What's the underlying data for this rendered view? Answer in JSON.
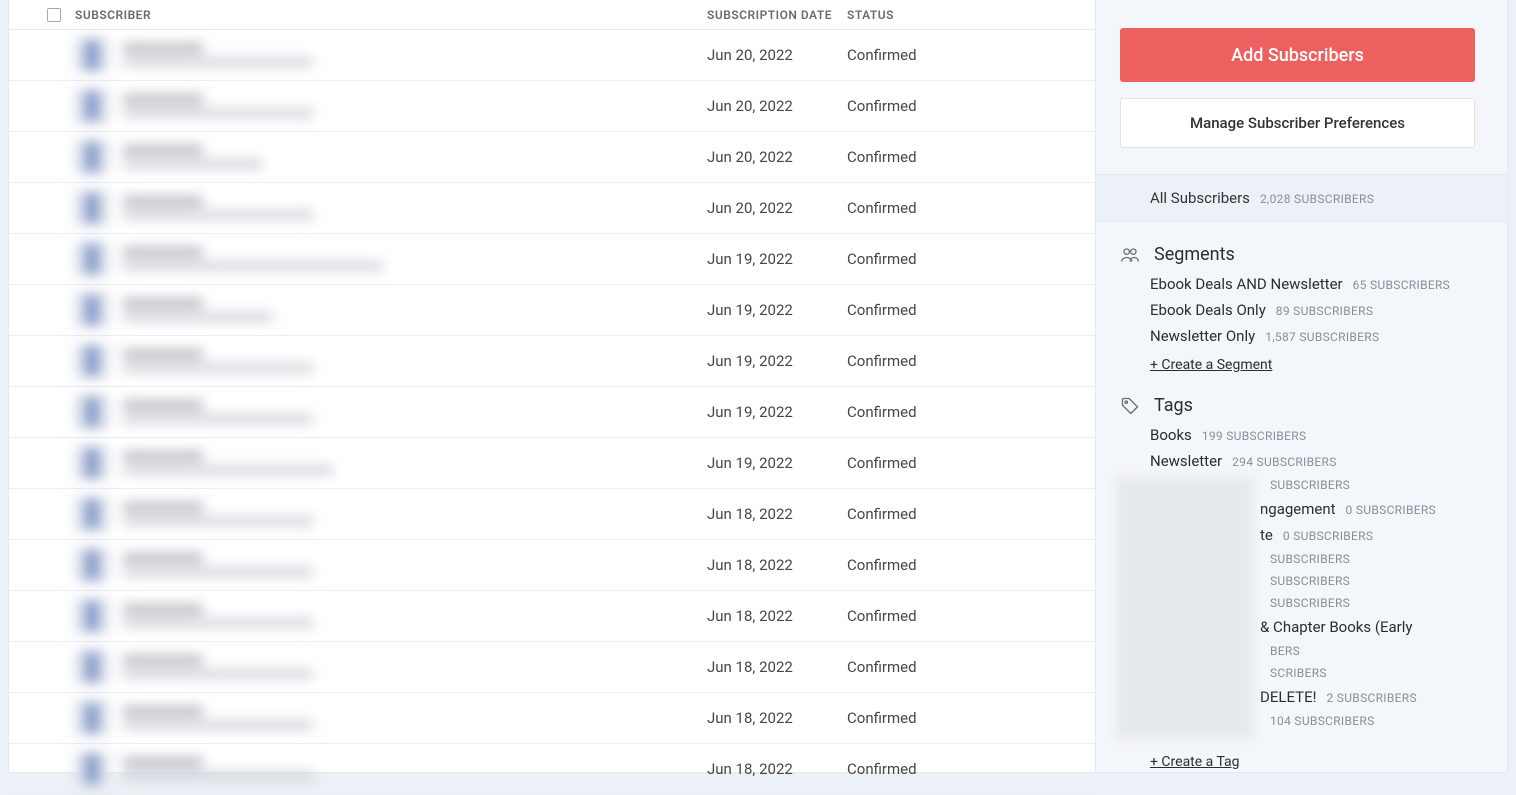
{
  "columns": {
    "subscriber": "SUBSCRIBER",
    "date": "SUBSCRIPTION DATE",
    "status": "STATUS"
  },
  "rows": [
    {
      "date": "Jun 20, 2022",
      "status": "Confirmed"
    },
    {
      "date": "Jun 20, 2022",
      "status": "Confirmed"
    },
    {
      "date": "Jun 20, 2022",
      "status": "Confirmed"
    },
    {
      "date": "Jun 20, 2022",
      "status": "Confirmed"
    },
    {
      "date": "Jun 19, 2022",
      "status": "Confirmed"
    },
    {
      "date": "Jun 19, 2022",
      "status": "Confirmed"
    },
    {
      "date": "Jun 19, 2022",
      "status": "Confirmed"
    },
    {
      "date": "Jun 19, 2022",
      "status": "Confirmed"
    },
    {
      "date": "Jun 19, 2022",
      "status": "Confirmed"
    },
    {
      "date": "Jun 18, 2022",
      "status": "Confirmed"
    },
    {
      "date": "Jun 18, 2022",
      "status": "Confirmed"
    },
    {
      "date": "Jun 18, 2022",
      "status": "Confirmed"
    },
    {
      "date": "Jun 18, 2022",
      "status": "Confirmed"
    },
    {
      "date": "Jun 18, 2022",
      "status": "Confirmed"
    },
    {
      "date": "Jun 18, 2022",
      "status": "Confirmed"
    }
  ],
  "sidebar": {
    "add_btn": "Add Subscribers",
    "manage_btn": "Manage Subscriber Preferences",
    "all_label": "All Subscribers",
    "all_count": "2,028 SUBSCRIBERS",
    "segments_title": "Segments",
    "segments": [
      {
        "label": "Ebook Deals AND Newsletter",
        "count": "65 SUBSCRIBERS"
      },
      {
        "label": "Ebook Deals Only",
        "count": "89 SUBSCRIBERS"
      },
      {
        "label": "Newsletter Only",
        "count": "1,587 SUBSCRIBERS"
      }
    ],
    "create_segment": "+ Create a Segment",
    "tags_title": "Tags",
    "tags": [
      {
        "label": "Books",
        "count": "199 SUBSCRIBERS"
      },
      {
        "label": "Newsletter",
        "count": "294 SUBSCRIBERS"
      },
      {
        "label": "",
        "count": "SUBSCRIBERS"
      },
      {
        "label": "ngagement",
        "count": "0 SUBSCRIBERS"
      },
      {
        "label": "te",
        "count": "0 SUBSCRIBERS"
      },
      {
        "label": "",
        "count": "SUBSCRIBERS"
      },
      {
        "label": "",
        "count": "SUBSCRIBERS"
      },
      {
        "label": "",
        "count": "SUBSCRIBERS"
      },
      {
        "label": "& Chapter Books (Early",
        "count": ""
      },
      {
        "label": "",
        "count": "BERS"
      },
      {
        "label": "",
        "count": "SCRIBERS"
      },
      {
        "label": "DELETE!",
        "count": "2 SUBSCRIBERS"
      },
      {
        "label": "",
        "count": "104 SUBSCRIBERS"
      }
    ],
    "create_tag": "+ Create a Tag"
  }
}
